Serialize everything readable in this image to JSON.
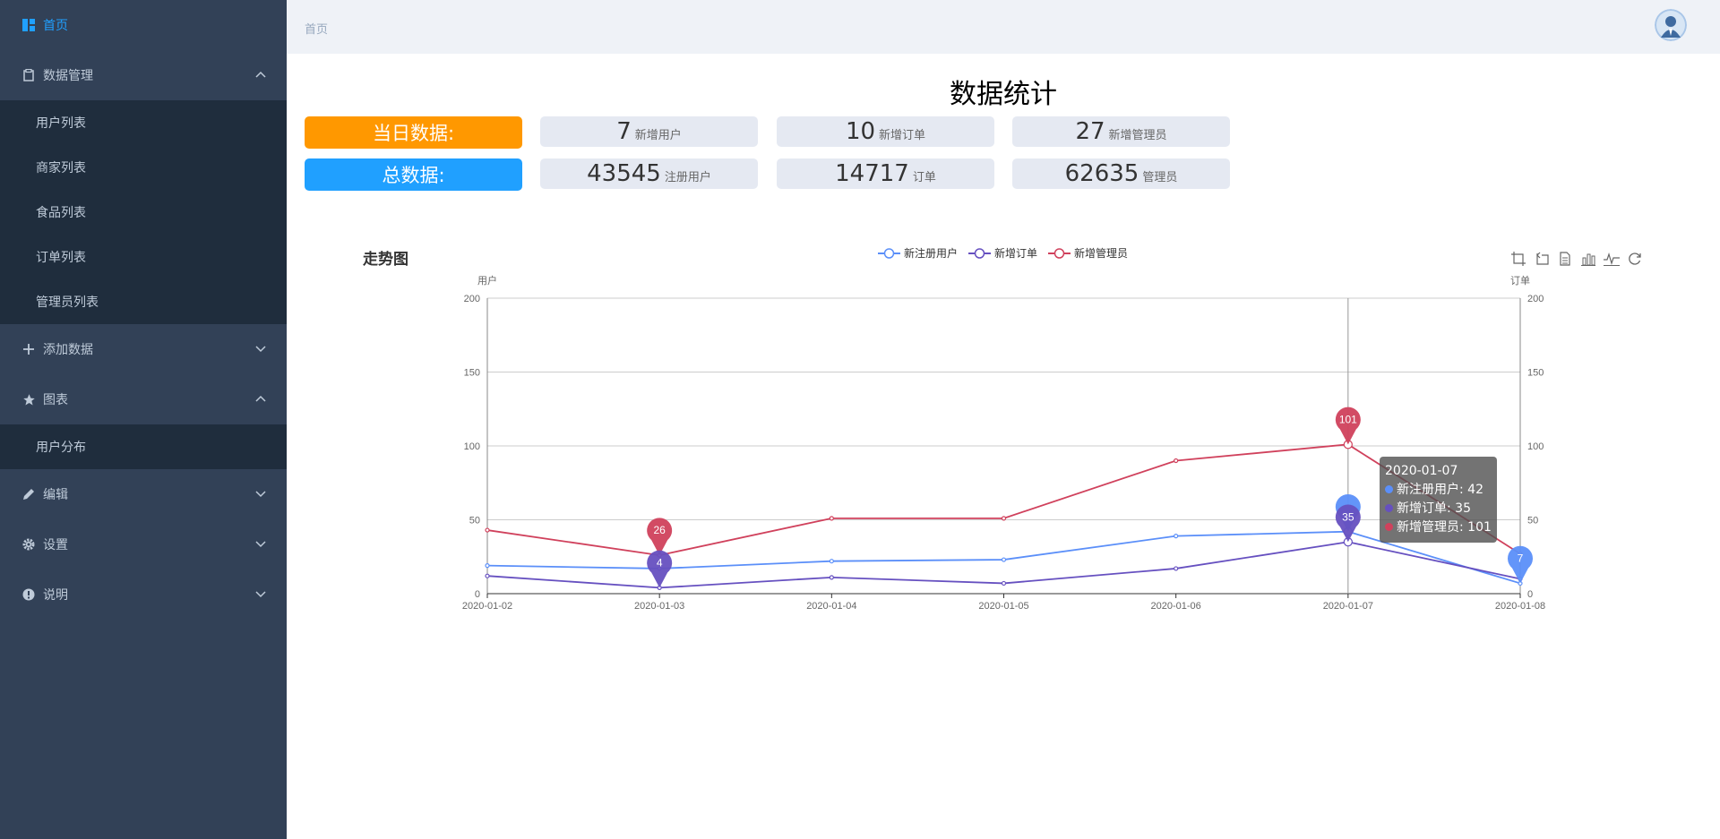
{
  "sidebar": {
    "home": {
      "label": "首页"
    },
    "data_mgmt": {
      "label": "数据管理",
      "items": [
        "用户列表",
        "商家列表",
        "食品列表",
        "订单列表",
        "管理员列表"
      ]
    },
    "add_data": {
      "label": "添加数据"
    },
    "charts": {
      "label": "图表",
      "items": [
        "用户分布"
      ]
    },
    "edit": {
      "label": "编辑"
    },
    "settings": {
      "label": "设置"
    },
    "about": {
      "label": "说明"
    }
  },
  "header": {
    "breadcrumb": "首页"
  },
  "main": {
    "title": "数据统计",
    "today": {
      "label": "当日数据:",
      "stats": [
        {
          "value": "7",
          "label": "新增用户"
        },
        {
          "value": "10",
          "label": "新增订单"
        },
        {
          "value": "27",
          "label": "新增管理员"
        }
      ]
    },
    "total": {
      "label": "总数据:",
      "stats": [
        {
          "value": "43545",
          "label": "注册用户"
        },
        {
          "value": "14717",
          "label": "订单"
        },
        {
          "value": "62635",
          "label": "管理员"
        }
      ]
    }
  },
  "colors": {
    "orange": "#ff9800",
    "blue": "#20a0ff",
    "series1": "#5b8ff9",
    "series2": "#6650c0",
    "series3": "#d0415c"
  },
  "toolbox": [
    "data-zoom-icon",
    "zoom-reset-icon",
    "data-view-icon",
    "bar-chart-icon",
    "line-chart-icon",
    "restore-icon"
  ],
  "chart_data": {
    "type": "line",
    "title": "走势图",
    "categories": [
      "2020-01-02",
      "2020-01-03",
      "2020-01-04",
      "2020-01-05",
      "2020-01-06",
      "2020-01-07",
      "2020-01-08"
    ],
    "series": [
      {
        "name": "新注册用户",
        "values": [
          19,
          17,
          22,
          23,
          39,
          42,
          7
        ],
        "color": "#5b8ff9",
        "axis": "left"
      },
      {
        "name": "新增订单",
        "values": [
          12,
          4,
          11,
          7,
          17,
          35,
          10
        ],
        "color": "#6650c0",
        "axis": "right"
      },
      {
        "name": "新增管理员",
        "values": [
          43,
          26,
          51,
          51,
          90,
          101,
          27
        ],
        "color": "#d0415c",
        "axis": "left"
      }
    ],
    "ylabel_left": "用户",
    "ylabel_right": "订单",
    "ylim": [
      0,
      200
    ],
    "yticks": [
      0,
      50,
      100,
      150,
      200
    ],
    "grid": true,
    "legend": "top-center",
    "markers": [
      {
        "series": 2,
        "index": 1,
        "label": "26"
      },
      {
        "series": 1,
        "index": 1,
        "label": "4"
      },
      {
        "series": 2,
        "index": 5,
        "label": "101"
      },
      {
        "series": 0,
        "index": 5,
        "label": ""
      },
      {
        "series": 1,
        "index": 5,
        "label": "35"
      },
      {
        "series": 0,
        "index": 6,
        "label": "7"
      }
    ],
    "tooltip": {
      "date": "2020-01-07",
      "lines": [
        "新注册用户: 42",
        "新增订单: 35",
        "新增管理员: 101"
      ]
    }
  }
}
